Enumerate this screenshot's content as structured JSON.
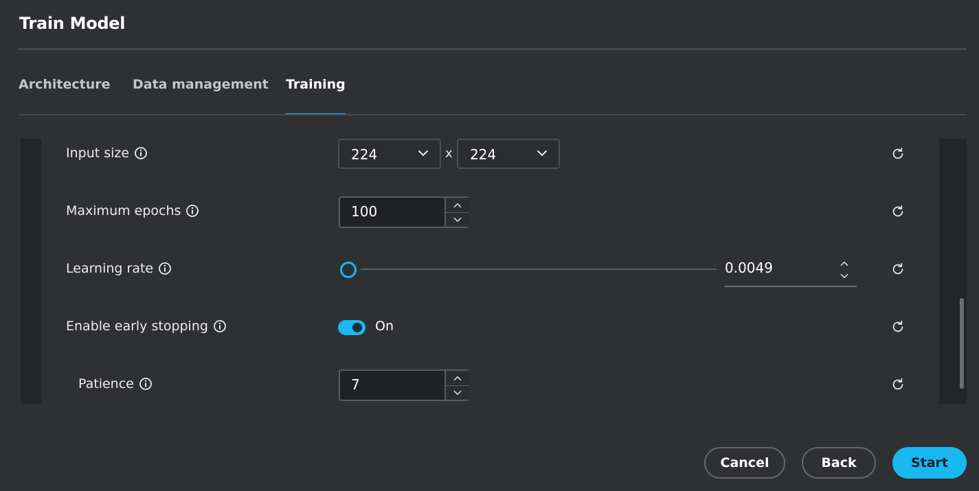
{
  "title": "Train Model",
  "tabs": [
    {
      "label": "Architecture",
      "active": false
    },
    {
      "label": "Data management",
      "active": false
    },
    {
      "label": "Training",
      "active": true
    }
  ],
  "settings": {
    "input_size": {
      "label": "Input size",
      "width": "224",
      "height": "224",
      "separator": "x"
    },
    "max_epochs": {
      "label": "Maximum epochs",
      "value": "100"
    },
    "learning_rate": {
      "label": "Learning rate",
      "value": "0.0049",
      "slider_fraction": 0.02
    },
    "early_stopping": {
      "label": "Enable early stopping",
      "state": "On",
      "enabled": true
    },
    "patience": {
      "label": "Patience",
      "value": "7"
    }
  },
  "icons": {
    "info": "info-icon",
    "reset": "reset-icon",
    "dropdown": "chevron-down-icon",
    "increment": "chevron-up-icon",
    "decrement": "chevron-down-icon"
  },
  "footer": {
    "cancel": "Cancel",
    "back": "Back",
    "start": "Start"
  },
  "colors": {
    "accent": "#19b8f0",
    "background": "#2f3034",
    "panel": "#242528"
  }
}
